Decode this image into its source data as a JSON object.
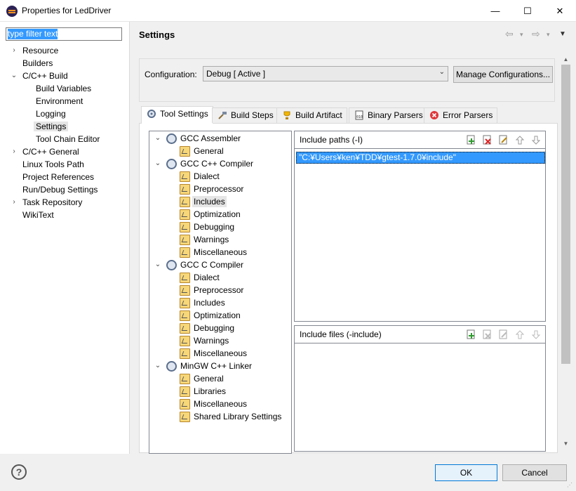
{
  "window": {
    "title": "Properties for LedDriver",
    "controls": {
      "minimize": "—",
      "maximize": "☐",
      "close": "✕"
    }
  },
  "left": {
    "filter": {
      "value": "type filter text"
    },
    "items": [
      {
        "label": "Resource",
        "twisty": "›"
      },
      {
        "label": "Builders"
      },
      {
        "label": "C/C++ Build",
        "twisty": "⌄"
      },
      {
        "label": "Build Variables"
      },
      {
        "label": "Environment"
      },
      {
        "label": "Logging"
      },
      {
        "label": "Settings",
        "selected": true
      },
      {
        "label": "Tool Chain Editor"
      },
      {
        "label": "C/C++ General",
        "twisty": "›"
      },
      {
        "label": "Linux Tools Path"
      },
      {
        "label": "Project References"
      },
      {
        "label": "Run/Debug Settings"
      },
      {
        "label": "Task Repository",
        "twisty": "›"
      },
      {
        "label": "WikiText"
      }
    ]
  },
  "header": {
    "title": "Settings",
    "nav": {
      "back": "⇦",
      "forward": "⇨",
      "dropdown": "▾",
      "menu": "▼"
    }
  },
  "config": {
    "label": "Configuration:",
    "value": "Debug  [ Active ]",
    "manage_label": "Manage Configurations..."
  },
  "tabs": [
    {
      "label": "Tool Settings",
      "active": true,
      "icon": "tool-settings-icon"
    },
    {
      "label": "Build Steps",
      "icon": "build-steps-icon"
    },
    {
      "label": "Build Artifact",
      "icon": "trophy-icon"
    },
    {
      "label": "Binary Parsers",
      "icon": "binary-icon"
    },
    {
      "label": "Error Parsers",
      "icon": "error-icon"
    }
  ],
  "tool_tree": [
    {
      "label": "GCC Assembler",
      "type": "tool",
      "twisty": "⌄"
    },
    {
      "label": "General",
      "type": "option"
    },
    {
      "label": "GCC C++ Compiler",
      "type": "tool",
      "twisty": "⌄"
    },
    {
      "label": "Dialect",
      "type": "option"
    },
    {
      "label": "Preprocessor",
      "type": "option"
    },
    {
      "label": "Includes",
      "type": "option",
      "selected": true
    },
    {
      "label": "Optimization",
      "type": "option"
    },
    {
      "label": "Debugging",
      "type": "option"
    },
    {
      "label": "Warnings",
      "type": "option"
    },
    {
      "label": "Miscellaneous",
      "type": "option"
    },
    {
      "label": "GCC C Compiler",
      "type": "tool",
      "twisty": "⌄"
    },
    {
      "label": "Dialect",
      "type": "option"
    },
    {
      "label": "Preprocessor",
      "type": "option"
    },
    {
      "label": "Includes",
      "type": "option"
    },
    {
      "label": "Optimization",
      "type": "option"
    },
    {
      "label": "Debugging",
      "type": "option"
    },
    {
      "label": "Warnings",
      "type": "option"
    },
    {
      "label": "Miscellaneous",
      "type": "option"
    },
    {
      "label": "MinGW C++ Linker",
      "type": "tool",
      "twisty": "⌄"
    },
    {
      "label": "General",
      "type": "option"
    },
    {
      "label": "Libraries",
      "type": "option"
    },
    {
      "label": "Miscellaneous",
      "type": "option"
    },
    {
      "label": "Shared Library Settings",
      "type": "option"
    }
  ],
  "include_paths": {
    "title": "Include paths (-I)",
    "items": [
      "\"C:¥Users¥ken¥TDD¥gtest-1.7.0¥include\""
    ]
  },
  "include_files": {
    "title": "Include files (-include)",
    "items": []
  },
  "footer": {
    "help": "?",
    "ok_label": "OK",
    "cancel_label": "Cancel"
  },
  "colors": {
    "selection": "#3399ff",
    "default_button_border": "#0078d7"
  }
}
